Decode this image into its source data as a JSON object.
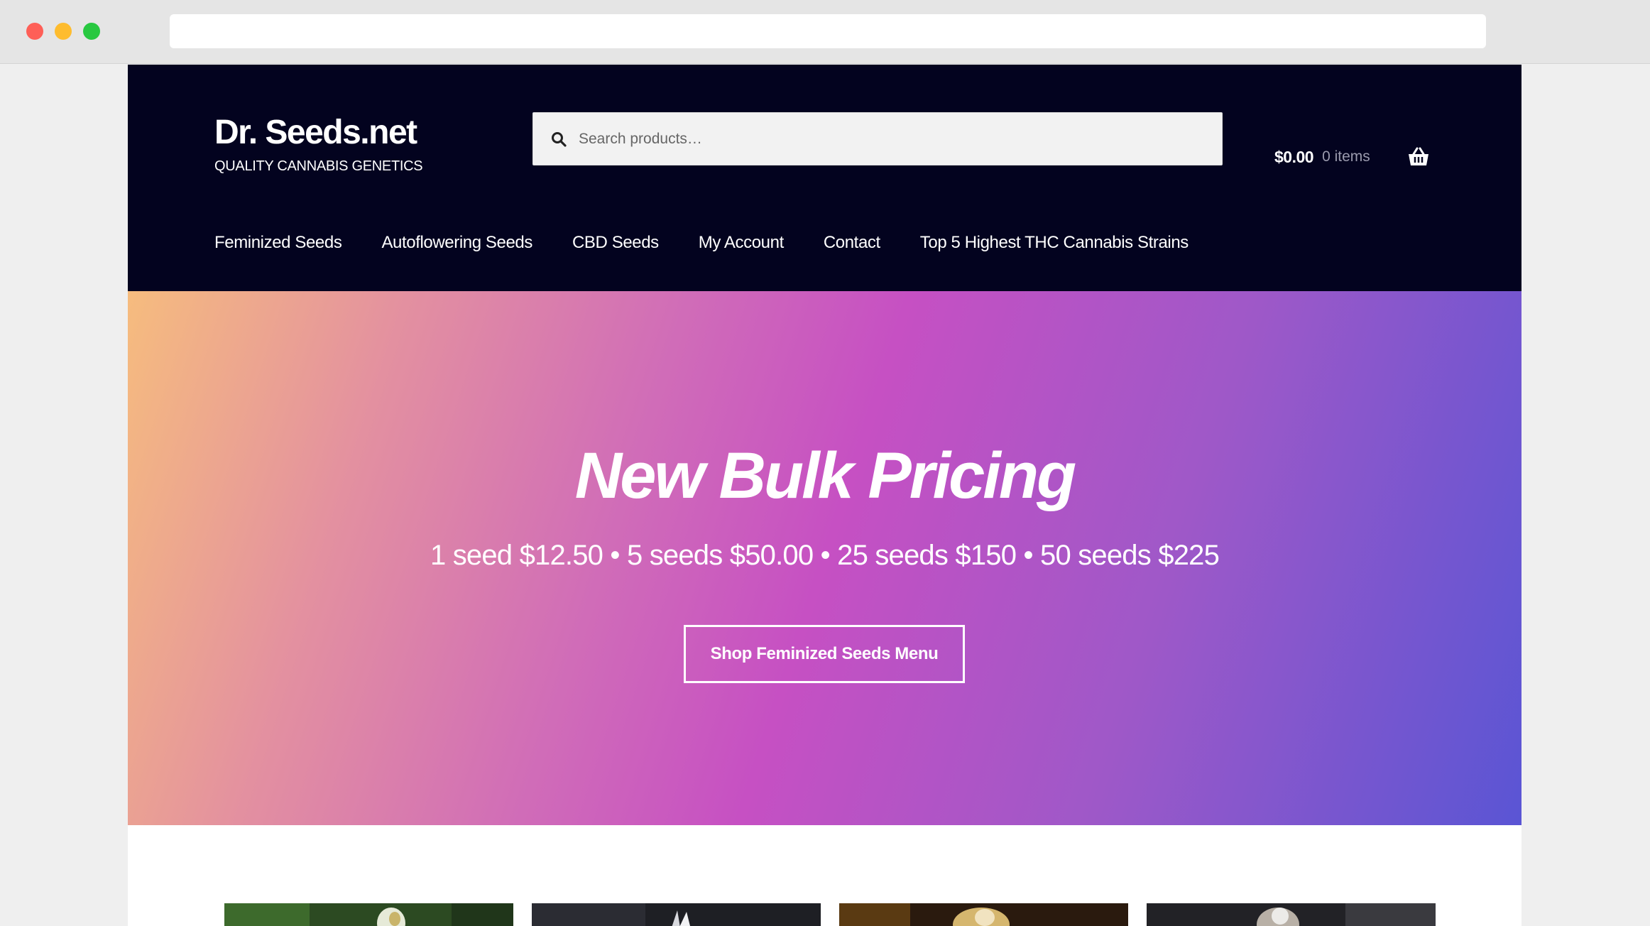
{
  "brand": {
    "title": "Dr. Seeds.net",
    "tagline": "QUALITY CANNABIS GENETICS"
  },
  "search": {
    "placeholder": "Search products…"
  },
  "cart": {
    "amount": "$0.00",
    "count": "0 items"
  },
  "nav": {
    "items": [
      "Feminized Seeds",
      "Autoflowering Seeds",
      "CBD Seeds",
      "My Account",
      "Contact",
      "Top 5 Highest THC Cannabis Strains"
    ]
  },
  "hero": {
    "title": "New Bulk Pricing",
    "subtitle": "1 seed $12.50 • 5 seeds $50.00 • 25 seeds $150 • 50 seeds $225",
    "button": "Shop Feminized Seeds Menu"
  },
  "colors": {
    "header_bg": "#03031f",
    "gradient_start": "#f6bc7e",
    "gradient_mid": "#c650c3",
    "gradient_end": "#5a55d4"
  },
  "products": [
    {
      "image": "cannabis-bud-green"
    },
    {
      "image": "cannabis-bud-dark"
    },
    {
      "image": "cannabis-bud-amber"
    },
    {
      "image": "cannabis-bud-frosty"
    }
  ]
}
